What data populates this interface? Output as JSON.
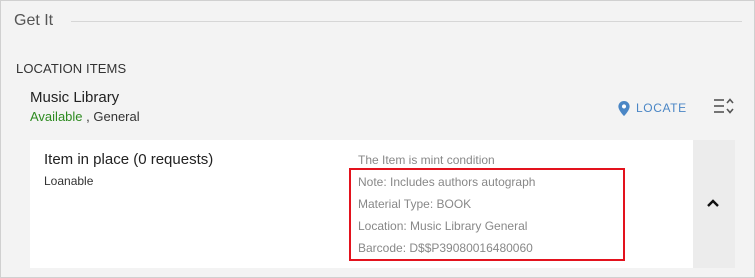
{
  "section": {
    "title": "Get It"
  },
  "location_items": {
    "heading": "LOCATION ITEMS"
  },
  "library": {
    "name": "Music Library",
    "availability": "Available",
    "separator": " , ",
    "location": "General",
    "locate_label": "LOCATE",
    "icons": {
      "locate": "map-pin-icon",
      "sort": "sort-lines-icon"
    }
  },
  "item": {
    "title": "Item in place (0 requests)",
    "policy": "Loanable",
    "details": [
      "The Item is mint condition",
      "Note: Includes authors autograph",
      "Material Type: BOOK",
      "Location: Music Library General",
      "Barcode: D$$P39080016480060"
    ],
    "expand_icon": "chevron-up-icon"
  },
  "colors": {
    "available": "#2e8b21",
    "accent": "#4a86c5",
    "highlight": "#e3121d",
    "detail_text": "#888888"
  }
}
